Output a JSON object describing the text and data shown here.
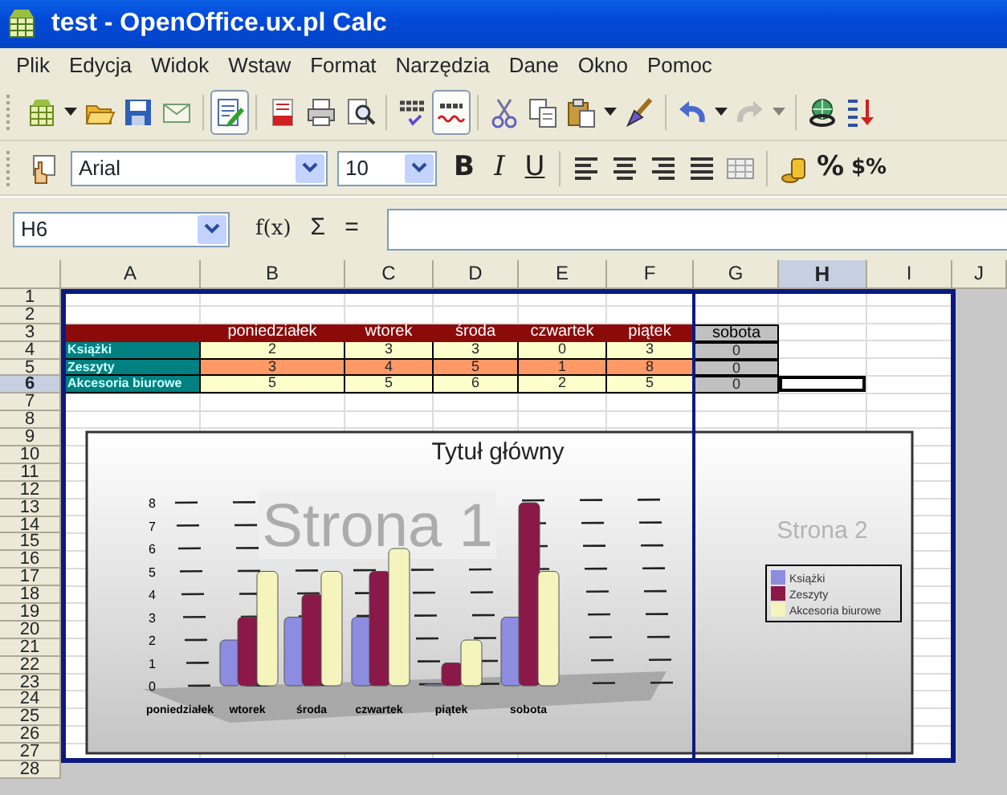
{
  "window": {
    "title": "test - OpenOffice.ux.pl Calc"
  },
  "menu": [
    "Plik",
    "Edycja",
    "Widok",
    "Wstaw",
    "Format",
    "Narzędzia",
    "Dane",
    "Okno",
    "Pomoc"
  ],
  "toolbar_standard": [
    {
      "kind": "new",
      "dropdown": true,
      "pressed": false,
      "disabled": false
    },
    {
      "kind": "open",
      "dropdown": false,
      "pressed": false,
      "disabled": false
    },
    {
      "kind": "save",
      "dropdown": false,
      "pressed": false,
      "disabled": false
    },
    {
      "kind": "email",
      "dropdown": false,
      "pressed": false,
      "disabled": false
    },
    {
      "kind": "separator"
    },
    {
      "kind": "edit",
      "dropdown": false,
      "pressed": true,
      "disabled": false
    },
    {
      "kind": "separator"
    },
    {
      "kind": "pdf",
      "dropdown": false,
      "pressed": false,
      "disabled": false
    },
    {
      "kind": "print",
      "dropdown": false,
      "pressed": false,
      "disabled": false
    },
    {
      "kind": "preview",
      "dropdown": false,
      "pressed": false,
      "disabled": false
    },
    {
      "kind": "separator"
    },
    {
      "kind": "spellcheck"
    },
    {
      "kind": "autospell",
      "dropdown": false,
      "pressed": true,
      "disabled": false
    },
    {
      "kind": "separator"
    },
    {
      "kind": "cut",
      "dropdown": false,
      "pressed": false,
      "disabled": false
    },
    {
      "kind": "copy",
      "dropdown": false,
      "pressed": false,
      "disabled": false
    },
    {
      "kind": "paste",
      "dropdown": true,
      "pressed": false,
      "disabled": false
    },
    {
      "kind": "brush",
      "dropdown": false,
      "pressed": false,
      "disabled": false
    },
    {
      "kind": "separator"
    },
    {
      "kind": "undo",
      "dropdown": true,
      "pressed": false,
      "disabled": false
    },
    {
      "kind": "redo",
      "dropdown": true,
      "pressed": false,
      "disabled": true
    },
    {
      "kind": "separator"
    },
    {
      "kind": "navigator",
      "dropdown": false,
      "pressed": false,
      "disabled": false
    },
    {
      "kind": "sort",
      "dropdown": false,
      "pressed": false,
      "disabled": false
    }
  ],
  "toolbar_formatting": [
    {
      "kind": "stylist",
      "pressed": false
    },
    {
      "kind": "font_name",
      "value": "Arial"
    },
    {
      "kind": "font_size",
      "value": "10"
    },
    {
      "kind": "bold",
      "label": "B",
      "pressed": false
    },
    {
      "kind": "italic",
      "label": "I",
      "pressed": false
    },
    {
      "kind": "underline",
      "label": "U",
      "pressed": false
    },
    {
      "kind": "separator"
    },
    {
      "kind": "align_left",
      "pressed": false
    },
    {
      "kind": "align_center",
      "pressed": false
    },
    {
      "kind": "align_right",
      "pressed": false
    },
    {
      "kind": "justify",
      "pressed": false
    },
    {
      "kind": "merge",
      "pressed": false
    },
    {
      "kind": "separator"
    },
    {
      "kind": "currency",
      "pressed": false
    },
    {
      "kind": "percent",
      "label": "%",
      "pressed": false
    },
    {
      "kind": "number_format",
      "label": "$%",
      "pressed": false
    }
  ],
  "formula_bar": {
    "cell_ref": "H6",
    "function_wizard": "f(x)",
    "sum": "Σ",
    "equals": "="
  },
  "sheet": {
    "columns": [
      {
        "label": "A",
        "selected": false,
        "print_range": true
      },
      {
        "label": "B",
        "selected": false,
        "print_range": true
      },
      {
        "label": "C",
        "selected": false,
        "print_range": true
      },
      {
        "label": "D",
        "selected": false,
        "print_range": true
      },
      {
        "label": "E",
        "selected": false,
        "print_range": true
      },
      {
        "label": "F",
        "selected": false,
        "print_range": true
      },
      {
        "label": "G",
        "selected": false,
        "print_range": true
      },
      {
        "label": "H",
        "selected": true,
        "print_range": true
      },
      {
        "label": "I",
        "selected": false,
        "print_range": true
      },
      {
        "label": "J",
        "selected": false,
        "print_range": false
      }
    ],
    "rows": [
      {
        "label": "1",
        "selected": false,
        "print_range": true
      },
      {
        "label": "2",
        "selected": false,
        "print_range": true
      },
      {
        "label": "3",
        "selected": false,
        "print_range": true,
        "cells": [
          {
            "kind": "header"
          },
          {
            "kind": "header",
            "text": "poniedziałek"
          },
          {
            "kind": "header",
            "text": "wtorek"
          },
          {
            "kind": "header",
            "text": "środa"
          },
          {
            "kind": "header",
            "text": "czwartek"
          },
          {
            "kind": "header",
            "text": "piątek"
          },
          {
            "kind": "extra_header",
            "text": "sobota"
          }
        ]
      },
      {
        "label": "4",
        "selected": false,
        "print_range": true,
        "cells": [
          {
            "kind": "row_label",
            "text": "Książki"
          },
          {
            "kind": "value",
            "text": "2"
          },
          {
            "kind": "value",
            "text": "3"
          },
          {
            "kind": "value",
            "text": "3"
          },
          {
            "kind": "value",
            "text": "0"
          },
          {
            "kind": "value",
            "text": "3"
          },
          {
            "kind": "extra_value",
            "text": "0"
          }
        ]
      },
      {
        "label": "5",
        "selected": false,
        "print_range": true,
        "cells": [
          {
            "kind": "row_label",
            "text": "Zeszyty"
          },
          {
            "kind": "value_alt",
            "text": "3"
          },
          {
            "kind": "value_alt",
            "text": "4"
          },
          {
            "kind": "value_alt",
            "text": "5"
          },
          {
            "kind": "value_alt",
            "text": "1"
          },
          {
            "kind": "value_alt",
            "text": "8"
          },
          {
            "kind": "extra_value",
            "text": "0"
          }
        ]
      },
      {
        "label": "6",
        "selected": true,
        "print_range": true,
        "cells": [
          {
            "kind": "row_label",
            "text": "Akcesoria biurowe"
          },
          {
            "kind": "value",
            "text": "5"
          },
          {
            "kind": "value",
            "text": "5"
          },
          {
            "kind": "value",
            "text": "6"
          },
          {
            "kind": "value",
            "text": "2"
          },
          {
            "kind": "value",
            "text": "5"
          },
          {
            "kind": "extra_value",
            "text": "0"
          }
        ]
      },
      {
        "label": "7",
        "selected": false,
        "print_range": true
      },
      {
        "label": "8",
        "selected": false,
        "print_range": true
      },
      {
        "label": "9",
        "selected": false,
        "print_range": true
      },
      {
        "label": "10",
        "selected": false,
        "print_range": true
      },
      {
        "label": "11",
        "selected": false,
        "print_range": true
      },
      {
        "label": "12",
        "selected": false,
        "print_range": true
      },
      {
        "label": "13",
        "selected": false,
        "print_range": true
      },
      {
        "label": "14",
        "selected": false,
        "print_range": true
      },
      {
        "label": "15",
        "selected": false,
        "print_range": true
      },
      {
        "label": "16",
        "selected": false,
        "print_range": true
      },
      {
        "label": "17",
        "selected": false,
        "print_range": true
      },
      {
        "label": "18",
        "selected": false,
        "print_range": true
      },
      {
        "label": "19",
        "selected": false,
        "print_range": true
      },
      {
        "label": "20",
        "selected": false,
        "print_range": true
      },
      {
        "label": "21",
        "selected": false,
        "print_range": true
      },
      {
        "label": "22",
        "selected": false,
        "print_range": true
      },
      {
        "label": "23",
        "selected": false,
        "print_range": true
      },
      {
        "label": "24",
        "selected": false,
        "print_range": true
      },
      {
        "label": "25",
        "selected": false,
        "print_range": true
      },
      {
        "label": "26",
        "selected": false,
        "print_range": true
      },
      {
        "label": "27",
        "selected": false,
        "print_range": true
      },
      {
        "label": "28",
        "selected": false,
        "print_range": false
      }
    ],
    "page_labels": [
      "Strona 1",
      "Strona 2"
    ],
    "chart": {
      "chart_data": {
        "type": "bar",
        "title": "Tytuł główny",
        "categories": [
          "poniedziałek",
          "wtorek",
          "środa",
          "czwartek",
          "piątek",
          "sobota"
        ],
        "series": [
          {
            "name": "Książki",
            "color": "#8c8ce0",
            "values": [
              null,
              2,
              3,
              3,
              0,
              3
            ]
          },
          {
            "name": "Zeszyty",
            "color": "#8a1848",
            "values": [
              null,
              3,
              4,
              5,
              1,
              8
            ]
          },
          {
            "name": "Akcesoria biurowe",
            "color": "#f4f4bc",
            "values": [
              null,
              5,
              5,
              6,
              2,
              5
            ]
          }
        ],
        "legend": "right",
        "ylim": [
          0,
          8
        ],
        "yticks": [
          {
            "value": 0,
            "label": "0"
          },
          {
            "value": 1,
            "label": "1"
          },
          {
            "value": 2,
            "label": "2"
          },
          {
            "value": 3,
            "label": "3"
          },
          {
            "value": 4,
            "label": "4"
          },
          {
            "value": 5,
            "label": "5"
          },
          {
            "value": 6,
            "label": "6"
          },
          {
            "value": 7,
            "label": "7"
          },
          {
            "value": 8,
            "label": "8"
          }
        ]
      }
    }
  }
}
